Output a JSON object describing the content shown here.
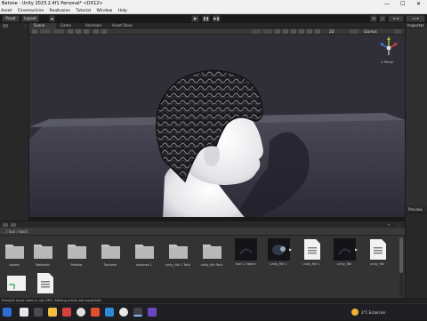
{
  "window": {
    "title": "Batone - Unity 2023.2.4f1 Personal* <DX12>",
    "min": "—",
    "max": "☐",
    "close": "✕"
  },
  "menu": [
    "Asset",
    "Cinemachine",
    "Realtusion",
    "Tutorial",
    "Window",
    "Help"
  ],
  "toolbar": {
    "left_buttons": [
      "Proxit",
      "Layout"
    ],
    "play_icons": [
      "▶",
      "❚❚",
      "▶❚"
    ]
  },
  "scene_tabs": [
    "Scene",
    "Game",
    "Animator",
    "Asset Store"
  ],
  "scene_tools": {
    "render_mode": "2D",
    "gizmos": "Gizmos"
  },
  "viewport": {
    "persp_label": "< Persp"
  },
  "right_panel": {
    "tab": "Inspector",
    "lower_header": "Preview"
  },
  "path": "... / hair / hair1",
  "assets": [
    {
      "name": "Assets",
      "kind": "folder"
    },
    {
      "name": "Materials",
      "kind": "folder"
    },
    {
      "name": "Prefabs",
      "kind": "folder"
    },
    {
      "name": "Textures",
      "kind": "folder"
    },
    {
      "name": "textures 1",
      "kind": "folder"
    },
    {
      "name": "unity_file 1 Tech",
      "kind": "folder"
    },
    {
      "name": "unity_file Tech",
      "kind": "folder"
    },
    {
      "name": "hair 1 Object",
      "kind": "dark"
    },
    {
      "name": "unity_file 1",
      "kind": "dark-blob"
    },
    {
      "name": "unity_file 1",
      "kind": "doc"
    },
    {
      "name": "unity_file",
      "kind": "dark"
    },
    {
      "name": "unity_file",
      "kind": "doc"
    },
    {
      "name": "",
      "kind": "special"
    },
    {
      "name": "",
      "kind": "doc"
    }
  ],
  "status": "Prevent more stats is not GPU. Setting errors are expected.",
  "taskbar": {
    "weather": "3°C  Eclaircies"
  },
  "colors": {
    "accent": "#3d7be0",
    "folder": "#c4c4c4",
    "skin": "#ececec",
    "hair": "#1b1b1e"
  }
}
